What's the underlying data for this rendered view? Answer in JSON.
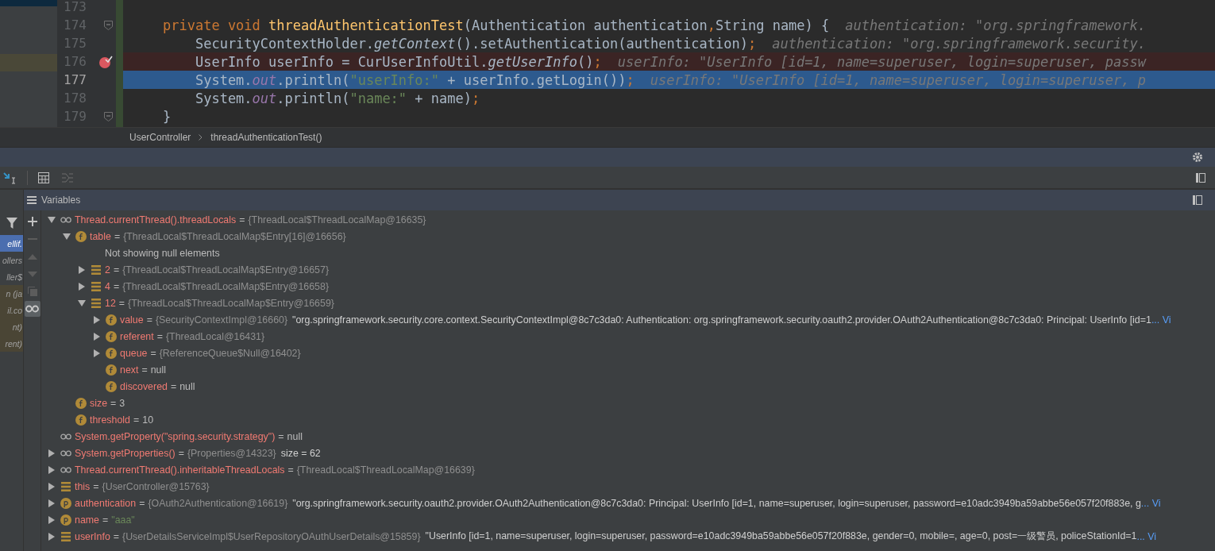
{
  "editor": {
    "lines": [
      {
        "number": "173",
        "kind": "plain"
      },
      {
        "number": "174",
        "kind": "plain",
        "fold": true,
        "tokens": [
          {
            "t": "private void ",
            "kind": "kw"
          },
          {
            "t": "threadAuthenticationTest",
            "kind": "fn"
          },
          {
            "t": "(Authentication authentication",
            "kind": "plain"
          },
          {
            "t": ",",
            "kind": "kw"
          },
          {
            "t": "String name) {",
            "kind": "plain"
          },
          {
            "t": "authentication: \"org.springframework.",
            "kind": "hint"
          }
        ]
      },
      {
        "number": "175",
        "kind": "plain",
        "tokens": [
          {
            "t": "    SecurityContextHolder.",
            "kind": "plain"
          },
          {
            "t": "getContext",
            "kind": "italic"
          },
          {
            "t": "().setAuthentication(authentication)",
            "kind": "plain"
          },
          {
            "t": ";",
            "kind": "kw"
          },
          {
            "t": "authentication: \"org.springframework.security.",
            "kind": "hint"
          }
        ]
      },
      {
        "number": "176",
        "kind": "breakpoint",
        "tokens": [
          {
            "t": "    UserInfo userInfo = CurUserInfoUtil.",
            "kind": "plain"
          },
          {
            "t": "getUserInfo",
            "kind": "italic"
          },
          {
            "t": "()",
            "kind": "plain"
          },
          {
            "t": ";",
            "kind": "kw"
          },
          {
            "t": "userInfo: \"UserInfo [id=1, name=superuser, login=superuser, passw",
            "kind": "hint"
          }
        ]
      },
      {
        "number": "177",
        "kind": "execution",
        "tokens": [
          {
            "t": "    System.",
            "kind": "plain"
          },
          {
            "t": "out",
            "kind": "static"
          },
          {
            "t": ".println(",
            "kind": "plain"
          },
          {
            "t": "\"userInfo:\"",
            "kind": "str"
          },
          {
            "t": " + userInfo.getLogin())",
            "kind": "plain"
          },
          {
            "t": ";",
            "kind": "kw"
          },
          {
            "t": "userInfo: \"UserInfo [id=1, name=superuser, login=superuser, p",
            "kind": "hint"
          }
        ]
      },
      {
        "number": "178",
        "kind": "plain",
        "tokens": [
          {
            "t": "    System.",
            "kind": "plain"
          },
          {
            "t": "out",
            "kind": "static"
          },
          {
            "t": ".println(",
            "kind": "plain"
          },
          {
            "t": "\"name:\"",
            "kind": "str"
          },
          {
            "t": " + name)",
            "kind": "plain"
          },
          {
            "t": ";",
            "kind": "kw"
          }
        ]
      },
      {
        "number": "179",
        "kind": "plain",
        "fold": true,
        "tokens": [
          {
            "t": "}",
            "kind": "plain"
          }
        ]
      }
    ]
  },
  "breadcrumb": [
    "UserController",
    "threadAuthenticationTest()"
  ],
  "frames": [
    {
      "text": "ellif.",
      "selected": true,
      "library": false
    },
    {
      "text": "ollers",
      "selected": false,
      "library": false
    },
    {
      "text": "ller$",
      "selected": false,
      "library": false
    },
    {
      "text": "n (ja",
      "selected": false,
      "library": true
    },
    {
      "text": "il.co",
      "selected": false,
      "library": true
    },
    {
      "text": "nt)",
      "selected": false,
      "library": true
    },
    {
      "text": "rent)",
      "selected": false,
      "library": true
    }
  ],
  "variables_panel": {
    "title": "Variables",
    "tree": [
      {
        "kind": "watch",
        "name": "Thread.currentThread().threadLocals",
        "eq": "=",
        "value": {
          "text": "{ThreadLocal$ThreadLocalMap@16635}",
          "kind": "ref"
        },
        "expanded": true,
        "children": [
          {
            "kind": "field",
            "name": "table",
            "eq": "=",
            "value": {
              "text": "{ThreadLocal$ThreadLocalMap$Entry[16]@16656}",
              "kind": "ref"
            },
            "expanded": true,
            "children": [
              {
                "kind": "note",
                "text": "Not showing null elements"
              },
              {
                "kind": "array",
                "name": "2",
                "eq": "=",
                "value": {
                  "text": "{ThreadLocal$ThreadLocalMap$Entry@16657}",
                  "kind": "ref"
                },
                "expanded": false
              },
              {
                "kind": "array",
                "name": "4",
                "eq": "=",
                "value": {
                  "text": "{ThreadLocal$ThreadLocalMap$Entry@16658}",
                  "kind": "ref"
                },
                "expanded": false
              },
              {
                "kind": "array",
                "name": "12",
                "eq": "=",
                "value": {
                  "text": "{ThreadLocal$ThreadLocalMap$Entry@16659}",
                  "kind": "ref"
                },
                "expanded": true,
                "children": [
                  {
                    "kind": "field",
                    "name": "value",
                    "eq": "=",
                    "value": {
                      "text": "{SecurityContextImpl@16660}",
                      "kind": "ref"
                    },
                    "summary": "\"org.springframework.security.core.context.SecurityContextImpl@8c7c3da0: Authentication: org.springframework.security.oauth2.provider.OAuth2Authentication@8c7c3da0: Principal: UserInfo [id=1",
                    "link": "... Vi",
                    "expanded": false
                  },
                  {
                    "kind": "field",
                    "name": "referent",
                    "eq": "=",
                    "value": {
                      "text": "{ThreadLocal@16431}",
                      "kind": "ref"
                    },
                    "expanded": false
                  },
                  {
                    "kind": "field",
                    "name": "queue",
                    "eq": "=",
                    "value": {
                      "text": "{ReferenceQueue$Null@16402}",
                      "kind": "ref"
                    },
                    "expanded": false
                  },
                  {
                    "kind": "field",
                    "name": "next",
                    "eq": "=",
                    "value": {
                      "text": "null",
                      "kind": "literal"
                    }
                  },
                  {
                    "kind": "field",
                    "name": "discovered",
                    "eq": "=",
                    "value": {
                      "text": "null",
                      "kind": "literal"
                    }
                  }
                ]
              }
            ]
          },
          {
            "kind": "field",
            "name": "size",
            "eq": "=",
            "value": {
              "text": "3",
              "kind": "literal"
            }
          },
          {
            "kind": "field",
            "name": "threshold",
            "eq": "=",
            "value": {
              "text": "10",
              "kind": "literal"
            }
          }
        ]
      },
      {
        "kind": "watch",
        "name": "System.getProperty(\"spring.security.strategy\")",
        "eq": "=",
        "value": {
          "text": "null",
          "kind": "literal"
        }
      },
      {
        "kind": "watch",
        "name": "System.getProperties()",
        "eq": "=",
        "value": {
          "text": "{Properties@14323}",
          "kind": "ref"
        },
        "summary": "size = 62",
        "expanded": false
      },
      {
        "kind": "watch",
        "name": "Thread.currentThread().inheritableThreadLocals",
        "eq": "=",
        "value": {
          "text": "{ThreadLocal$ThreadLocalMap@16639}",
          "kind": "ref"
        },
        "expanded": false
      },
      {
        "kind": "array",
        "name": "this",
        "eq": "=",
        "value": {
          "text": "{UserController@15763}",
          "kind": "ref"
        },
        "expanded": false
      },
      {
        "kind": "param",
        "name": "authentication",
        "eq": "=",
        "value": {
          "text": "{OAuth2Authentication@16619}",
          "kind": "ref"
        },
        "summary": "\"org.springframework.security.oauth2.provider.OAuth2Authentication@8c7c3da0: Principal: UserInfo [id=1, name=superuser, login=superuser, password=e10adc3949ba59abbe56e057f20f883e, g",
        "link": "... Vi",
        "expanded": false
      },
      {
        "kind": "param",
        "name": "name",
        "eq": "=",
        "value": {
          "text": "\"aaa\"",
          "kind": "string"
        },
        "expanded": false
      },
      {
        "kind": "array",
        "name": "userInfo",
        "eq": "=",
        "value": {
          "text": "{UserDetailsServiceImpl$UserRepositoryOAuthUserDetails@15859}",
          "kind": "ref"
        },
        "summary": "\"UserInfo [id=1, name=superuser, login=superuser, password=e10adc3949ba59abbe56e057f20f883e, gender=0, mobile=, age=0, post=一级警员, policeStationId=1",
        "link": "... Vi",
        "expanded": false
      }
    ]
  }
}
